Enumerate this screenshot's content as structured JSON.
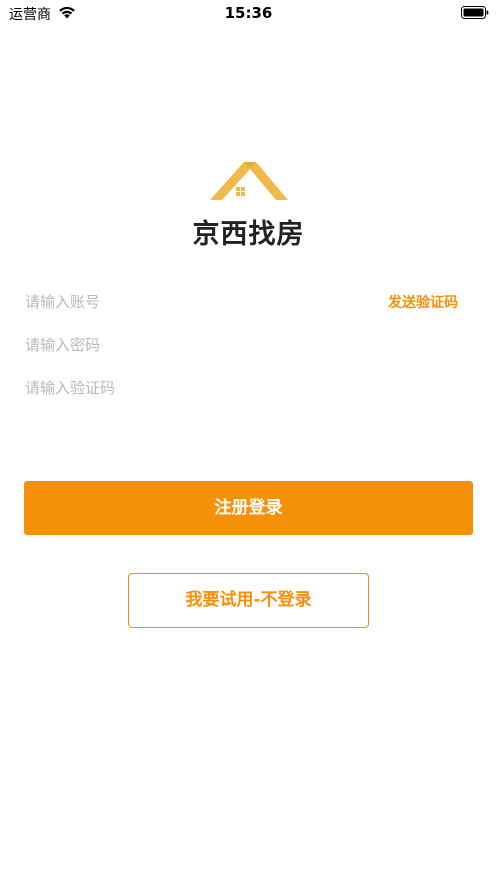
{
  "status": {
    "carrier": "运营商",
    "time": "15:36"
  },
  "brand": {
    "name": "京西找房",
    "accent": "#f5900a",
    "logo_color": "#f0b94a"
  },
  "form": {
    "account_placeholder": "请输入账号",
    "password_placeholder": "请输入密码",
    "code_placeholder": "请输入验证码",
    "send_code_label": "发送验证码"
  },
  "actions": {
    "register_login_label": "注册登录",
    "trial_label": "我要试用-不登录"
  }
}
